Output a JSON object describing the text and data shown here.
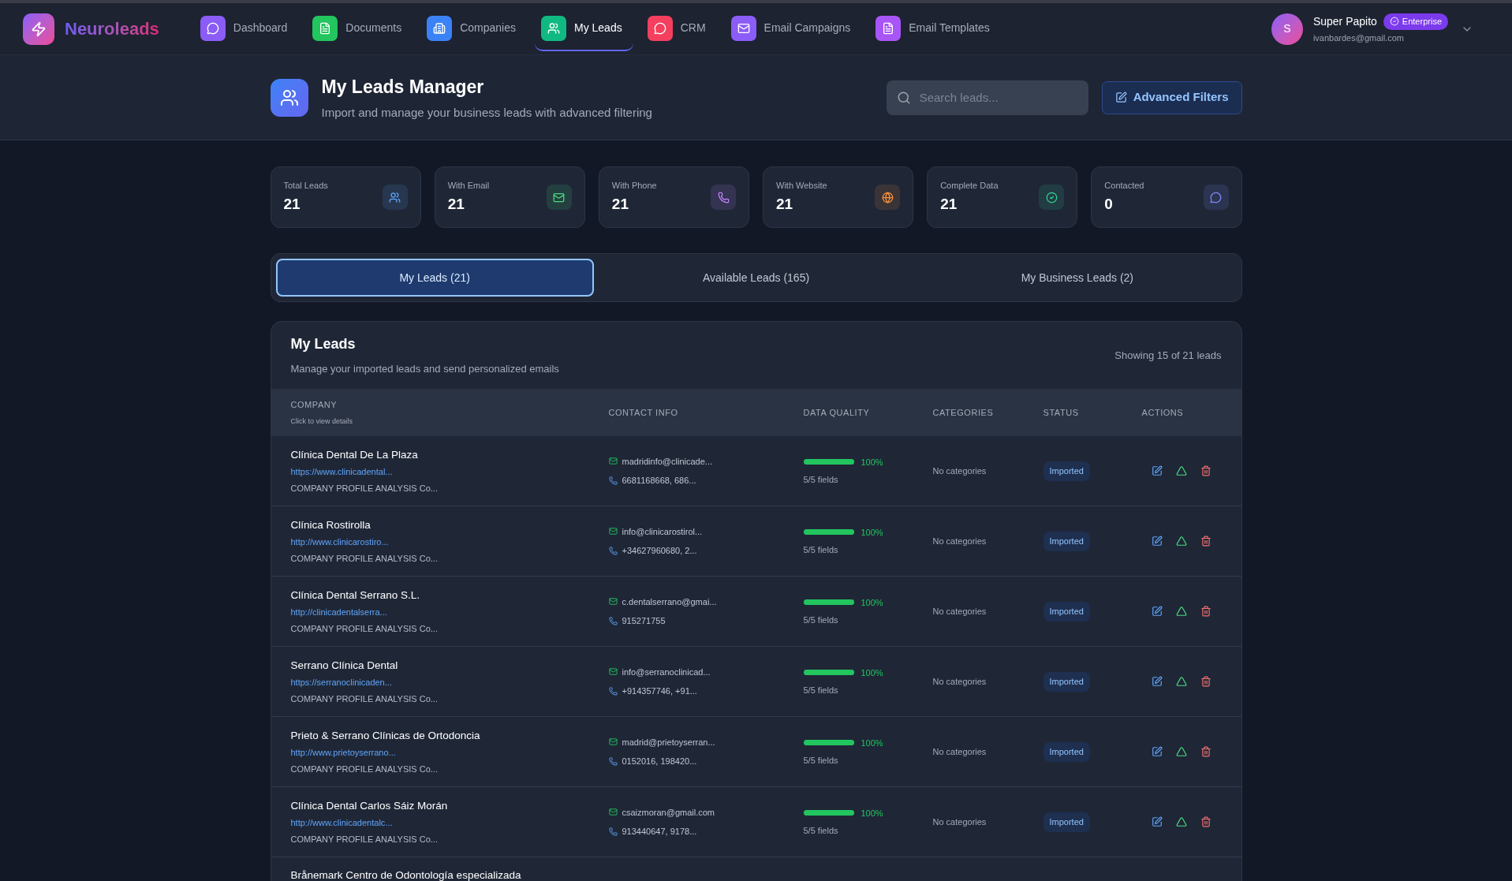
{
  "brand": "Neuroleads",
  "nav": [
    {
      "label": "Dashboard",
      "color": "#8b5cf6",
      "selected": false
    },
    {
      "label": "Documents",
      "color": "#22c55e",
      "selected": false
    },
    {
      "label": "Companies",
      "color": "#3b82f6",
      "selected": false
    },
    {
      "label": "My Leads",
      "color": "#10b981",
      "selected": true
    },
    {
      "label": "CRM",
      "color": "#f43f5e",
      "selected": false
    },
    {
      "label": "Email Campaigns",
      "color": "#8b5cf6",
      "selected": false
    },
    {
      "label": "Email Templates",
      "color": "#a855f7",
      "selected": false
    }
  ],
  "user": {
    "initial": "S",
    "name": "Super Papito",
    "plan": "Enterprise",
    "email": "ivanbardes@gmail.com"
  },
  "header": {
    "title": "My Leads Manager",
    "subtitle": "Import and manage your business leads with advanced filtering",
    "search": {
      "placeholder": "Search leads..."
    },
    "filters_button": "Advanced Filters"
  },
  "stats": [
    {
      "label": "Total Leads",
      "value": "21",
      "color": "#60a5fa"
    },
    {
      "label": "With Email",
      "value": "21",
      "color": "#4ade80"
    },
    {
      "label": "With Phone",
      "value": "21",
      "color": "#c084fc"
    },
    {
      "label": "With Website",
      "value": "21",
      "color": "#fb923c"
    },
    {
      "label": "Complete Data",
      "value": "21",
      "color": "#34d399"
    },
    {
      "label": "Contacted",
      "value": "0",
      "color": "#818cf8"
    }
  ],
  "tabs": [
    {
      "label": "My Leads (21)",
      "selected": true
    },
    {
      "label": "Available Leads (165)",
      "selected": false
    },
    {
      "label": "My Business Leads (2)",
      "selected": false
    }
  ],
  "table": {
    "title": "My Leads",
    "subtitle": "Manage your imported leads and send personalized emails",
    "showing": "Showing 15 of 21 leads",
    "columns": [
      {
        "label": "COMPANY",
        "hint": "Click to view details"
      },
      {
        "label": "CONTACT INFO"
      },
      {
        "label": "DATA QUALITY"
      },
      {
        "label": "CATEGORIES"
      },
      {
        "label": "STATUS"
      },
      {
        "label": "ACTIONS"
      }
    ],
    "rows": [
      {
        "kind": "full",
        "company": "Clínica Dental De La Plaza",
        "url": "https://www.clinicadental...",
        "note": "COMPANY PROFILE ANALYSIS Co...",
        "email": "madridinfo@clinicade...",
        "phone": "6681168668, 686...",
        "level": 1,
        "quality": "100%",
        "fields": "5/5 fields",
        "categories": "No categories",
        "status": "Imported"
      },
      {
        "kind": "full",
        "company": "Clínica Rostirolla",
        "url": "http://www.clinicarostiro...",
        "note": "COMPANY PROFILE ANALYSIS Co...",
        "email": "info@clinicarostirol...",
        "phone": "+34627960680, 2...",
        "level": 1,
        "quality": "100%",
        "fields": "5/5 fields",
        "categories": "No categories",
        "status": "Imported"
      },
      {
        "kind": "full",
        "company": "Clínica Dental Serrano S.L.",
        "url": "http://clinicadentalserra...",
        "note": "COMPANY PROFILE ANALYSIS Co...",
        "email": "c.dentalserrano@gmai...",
        "phone": "915271755",
        "level": 1,
        "quality": "100%",
        "fields": "5/5 fields",
        "categories": "No categories",
        "status": "Imported"
      },
      {
        "kind": "full",
        "company": "Serrano Clínica Dental",
        "url": "https://serranoclinicaden...",
        "note": "COMPANY PROFILE ANALYSIS Co...",
        "email": "info@serranoclinicad...",
        "phone": "+914357746, +91...",
        "level": 1,
        "quality": "100%",
        "fields": "5/5 fields",
        "categories": "No categories",
        "status": "Imported"
      },
      {
        "kind": "full",
        "company": "Prieto & Serrano Clínicas de Ortodoncia",
        "url": "http://www.prietoyserrano...",
        "note": "COMPANY PROFILE ANALYSIS Co...",
        "email": "madrid@prietoyserran...",
        "phone": "0152016, 198420...",
        "level": 1,
        "quality": "100%",
        "fields": "5/5 fields",
        "categories": "No categories",
        "status": "Imported"
      },
      {
        "kind": "full",
        "company": "Clínica Dental Carlos Sáiz Morán",
        "url": "http://www.clinicadentalc...",
        "note": "COMPANY PROFILE ANALYSIS Co...",
        "email": "csaizmoran@gmail.com",
        "phone": "913440647, 9178...",
        "level": 1,
        "quality": "100%",
        "fields": "5/5 fields",
        "categories": "No categories",
        "status": "Imported"
      },
      {
        "kind": "partial",
        "company": "Brånemark Centro de Odontología especializada"
      }
    ]
  }
}
